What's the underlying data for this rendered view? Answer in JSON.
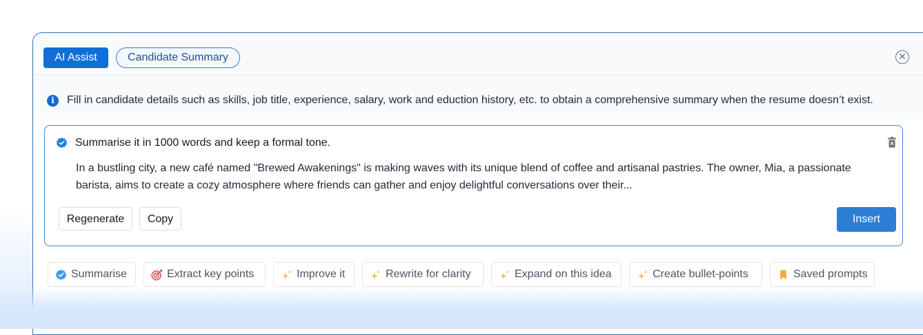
{
  "header": {
    "ai_assist_label": "AI Assist",
    "mode_label": "Candidate Summary",
    "close_icon": "close-circle-icon"
  },
  "info": {
    "icon": "info-icon",
    "text": "Fill in candidate details such as skills, job title, experience, salary, work and eduction history, etc. to obtain a comprehensive summary when the resume doesn’t exist."
  },
  "result": {
    "prompt": "Summarise it in 1000 words and keep a formal tone.",
    "body": "In a bustling city, a new café named \"Brewed Awakenings\" is making waves with its unique blend of coffee and artisanal pastries. The owner, Mia, a passionate barista, aims to create a cozy atmosphere where friends can gather and enjoy delightful conversations over their...",
    "regenerate_label": "Regenerate",
    "copy_label": "Copy",
    "insert_label": "Insert"
  },
  "quick_actions": [
    {
      "label": "Summarise",
      "icon": "verified-badge-icon"
    },
    {
      "label": "Extract key points",
      "icon": "target-icon"
    },
    {
      "label": "Improve it",
      "icon": "sparkle-icon"
    },
    {
      "label": "Rewrite for clarity",
      "icon": "sparkle-icon"
    },
    {
      "label": "Expand on this idea",
      "icon": "sparkle-icon"
    },
    {
      "label": "Create bullet-points",
      "icon": "sparkle-icon"
    },
    {
      "label": "Saved prompts",
      "icon": "bookmark-icon"
    }
  ],
  "colors": {
    "primary": "#0f6fd6",
    "border": "#2f6fb7",
    "insert": "#2d7fd6",
    "sparkle": "#f5b942"
  }
}
